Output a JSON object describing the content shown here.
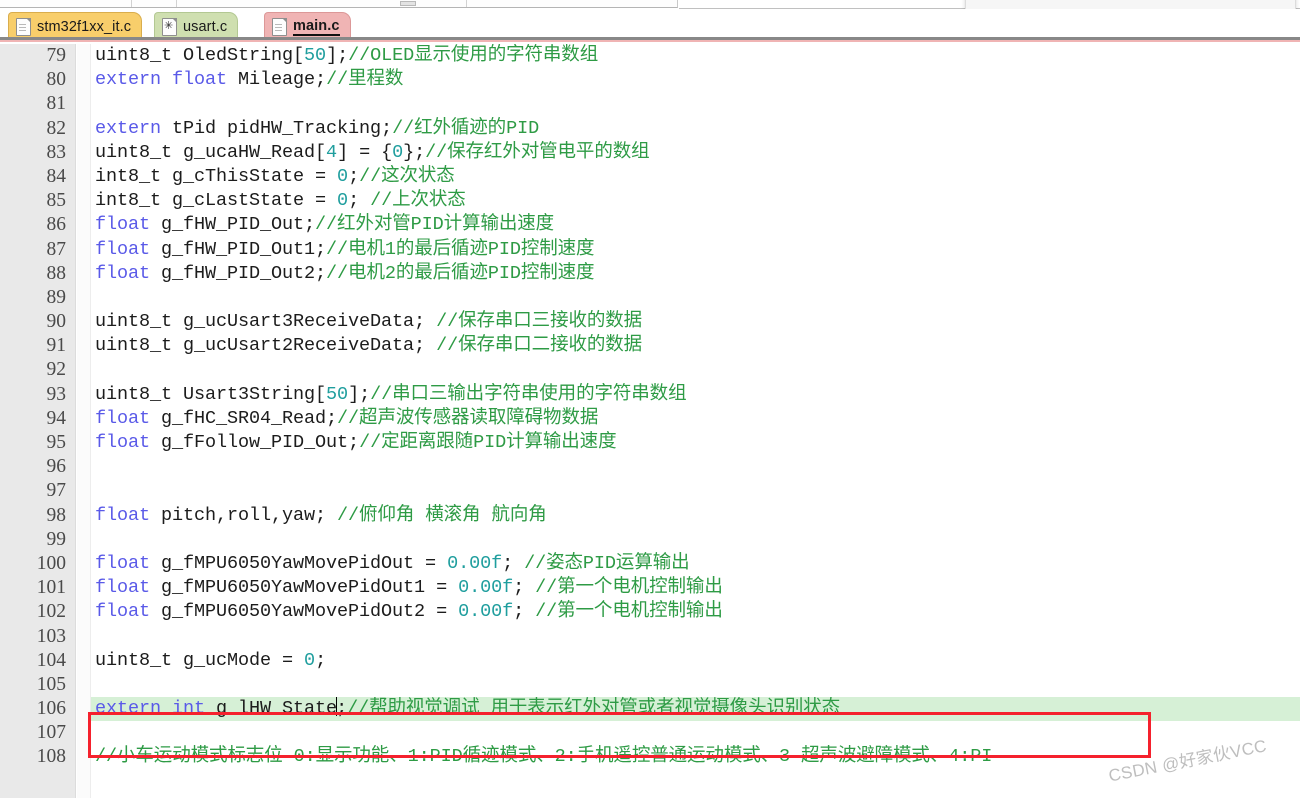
{
  "window": {
    "editor_type": "c-source-code-editor"
  },
  "popup": {
    "glyph": "C"
  },
  "tabs": [
    {
      "label": "stm32f1xx_it.c",
      "icon": "file-icon",
      "active": false,
      "modified": false,
      "color": "#f8ce6b"
    },
    {
      "label": "usart.c",
      "icon": "file-modified-icon",
      "active": false,
      "modified": true,
      "color": "#cfdfb0"
    },
    {
      "label": "main.c",
      "icon": "file-icon",
      "active": true,
      "modified": false,
      "color": "#f0b4b4"
    }
  ],
  "editor": {
    "first_line": 79,
    "highlight_line": 106,
    "highlight_color": "#d6f0d6",
    "annotation_box_color": "#f5212d",
    "syntax_colors": {
      "keyword": "#5a5ae8",
      "number": "#1f9e9e",
      "comment": "#2e9b45",
      "text": "#1c1c1c",
      "gutter_bg": "#e9e9e9"
    },
    "lines": [
      {
        "n": 79,
        "tokens": [
          {
            "t": "txt",
            "v": "uint8_t OledString["
          },
          {
            "t": "num",
            "v": "50"
          },
          {
            "t": "txt",
            "v": "];"
          },
          {
            "t": "com",
            "v": "//OLED显示使用的字符串数组"
          }
        ]
      },
      {
        "n": 80,
        "tokens": [
          {
            "t": "kw",
            "v": "extern float"
          },
          {
            "t": "txt",
            "v": " Mileage;"
          },
          {
            "t": "com",
            "v": "//里程数"
          }
        ]
      },
      {
        "n": 81,
        "tokens": []
      },
      {
        "n": 82,
        "tokens": [
          {
            "t": "kw",
            "v": "extern"
          },
          {
            "t": "txt",
            "v": " tPid pidHW_Tracking;"
          },
          {
            "t": "com",
            "v": "//红外循迹的PID"
          }
        ]
      },
      {
        "n": 83,
        "tokens": [
          {
            "t": "txt",
            "v": "uint8_t g_ucaHW_Read["
          },
          {
            "t": "num",
            "v": "4"
          },
          {
            "t": "txt",
            "v": "] = {"
          },
          {
            "t": "num",
            "v": "0"
          },
          {
            "t": "txt",
            "v": "};"
          },
          {
            "t": "com",
            "v": "//保存红外对管电平的数组"
          }
        ]
      },
      {
        "n": 84,
        "tokens": [
          {
            "t": "txt",
            "v": "int8_t g_cThisState = "
          },
          {
            "t": "num",
            "v": "0"
          },
          {
            "t": "txt",
            "v": ";"
          },
          {
            "t": "com",
            "v": "//这次状态"
          }
        ]
      },
      {
        "n": 85,
        "tokens": [
          {
            "t": "txt",
            "v": "int8_t g_cLastState = "
          },
          {
            "t": "num",
            "v": "0"
          },
          {
            "t": "txt",
            "v": "; "
          },
          {
            "t": "com",
            "v": "//上次状态"
          }
        ]
      },
      {
        "n": 86,
        "tokens": [
          {
            "t": "kw",
            "v": "float"
          },
          {
            "t": "txt",
            "v": " g_fHW_PID_Out;"
          },
          {
            "t": "com",
            "v": "//红外对管PID计算输出速度"
          }
        ]
      },
      {
        "n": 87,
        "tokens": [
          {
            "t": "kw",
            "v": "float"
          },
          {
            "t": "txt",
            "v": " g_fHW_PID_Out1;"
          },
          {
            "t": "com",
            "v": "//电机1的最后循迹PID控制速度"
          }
        ]
      },
      {
        "n": 88,
        "tokens": [
          {
            "t": "kw",
            "v": "float"
          },
          {
            "t": "txt",
            "v": " g_fHW_PID_Out2;"
          },
          {
            "t": "com",
            "v": "//电机2的最后循迹PID控制速度"
          }
        ]
      },
      {
        "n": 89,
        "tokens": []
      },
      {
        "n": 90,
        "tokens": [
          {
            "t": "txt",
            "v": "uint8_t g_ucUsart3ReceiveData;   "
          },
          {
            "t": "com",
            "v": "//保存串口三接收的数据"
          }
        ]
      },
      {
        "n": 91,
        "tokens": [
          {
            "t": "txt",
            "v": "uint8_t g_ucUsart2ReceiveData;   "
          },
          {
            "t": "com",
            "v": "//保存串口二接收的数据"
          }
        ]
      },
      {
        "n": 92,
        "tokens": []
      },
      {
        "n": 93,
        "tokens": [
          {
            "t": "txt",
            "v": "uint8_t Usart3String["
          },
          {
            "t": "num",
            "v": "50"
          },
          {
            "t": "txt",
            "v": "];"
          },
          {
            "t": "com",
            "v": "//串口三输出字符串使用的字符串数组"
          }
        ]
      },
      {
        "n": 94,
        "tokens": [
          {
            "t": "kw",
            "v": "float"
          },
          {
            "t": "txt",
            "v": " g_fHC_SR04_Read;"
          },
          {
            "t": "com",
            "v": "//超声波传感器读取障碍物数据"
          }
        ]
      },
      {
        "n": 95,
        "tokens": [
          {
            "t": "kw",
            "v": "float"
          },
          {
            "t": "txt",
            "v": " g_fFollow_PID_Out;"
          },
          {
            "t": "com",
            "v": "//定距离跟随PID计算输出速度"
          }
        ]
      },
      {
        "n": 96,
        "tokens": []
      },
      {
        "n": 97,
        "tokens": []
      },
      {
        "n": 98,
        "tokens": [
          {
            "t": "kw",
            "v": "float"
          },
          {
            "t": "txt",
            "v": " pitch,roll,yaw; "
          },
          {
            "t": "com",
            "v": "//俯仰角 横滚角 航向角"
          }
        ]
      },
      {
        "n": 99,
        "tokens": []
      },
      {
        "n": 100,
        "tokens": [
          {
            "t": "kw",
            "v": "float"
          },
          {
            "t": "txt",
            "v": "  g_fMPU6050YawMovePidOut = "
          },
          {
            "t": "num",
            "v": "0.00f"
          },
          {
            "t": "txt",
            "v": "; "
          },
          {
            "t": "com",
            "v": "//姿态PID运算输出"
          }
        ]
      },
      {
        "n": 101,
        "tokens": [
          {
            "t": "kw",
            "v": "float"
          },
          {
            "t": "txt",
            "v": "  g_fMPU6050YawMovePidOut1 = "
          },
          {
            "t": "num",
            "v": "0.00f"
          },
          {
            "t": "txt",
            "v": "; "
          },
          {
            "t": "com",
            "v": "//第一个电机控制输出"
          }
        ]
      },
      {
        "n": 102,
        "tokens": [
          {
            "t": "kw",
            "v": "float"
          },
          {
            "t": "txt",
            "v": "  g_fMPU6050YawMovePidOut2 = "
          },
          {
            "t": "num",
            "v": "0.00f"
          },
          {
            "t": "txt",
            "v": "; "
          },
          {
            "t": "com",
            "v": "//第一个电机控制输出"
          }
        ]
      },
      {
        "n": 103,
        "tokens": []
      },
      {
        "n": 104,
        "tokens": [
          {
            "t": "txt",
            "v": "uint8_t g_ucMode = "
          },
          {
            "t": "num",
            "v": "0"
          },
          {
            "t": "txt",
            "v": ";"
          }
        ]
      },
      {
        "n": 105,
        "tokens": []
      },
      {
        "n": 106,
        "highlight": true,
        "tokens": [
          {
            "t": "kw",
            "v": "extern int"
          },
          {
            "t": "txt",
            "v": " g_lHW_State"
          },
          {
            "t": "cursor",
            "v": ""
          },
          {
            "t": "txt",
            "v": ";"
          },
          {
            "t": "com",
            "v": "//帮助视觉调试 用于表示红外对管或者视觉摄像头识别状态"
          }
        ]
      },
      {
        "n": 107,
        "tokens": []
      },
      {
        "n": 108,
        "tokens": [
          {
            "t": "com",
            "v": "//小车运动模式标志位 0:显示功能、1:PID循迹模式、2:手机遥控普通运动模式、3 超声波避障模式、4:PI"
          }
        ]
      }
    ]
  },
  "watermark": {
    "text": "CSDN @好家伙VCC"
  }
}
